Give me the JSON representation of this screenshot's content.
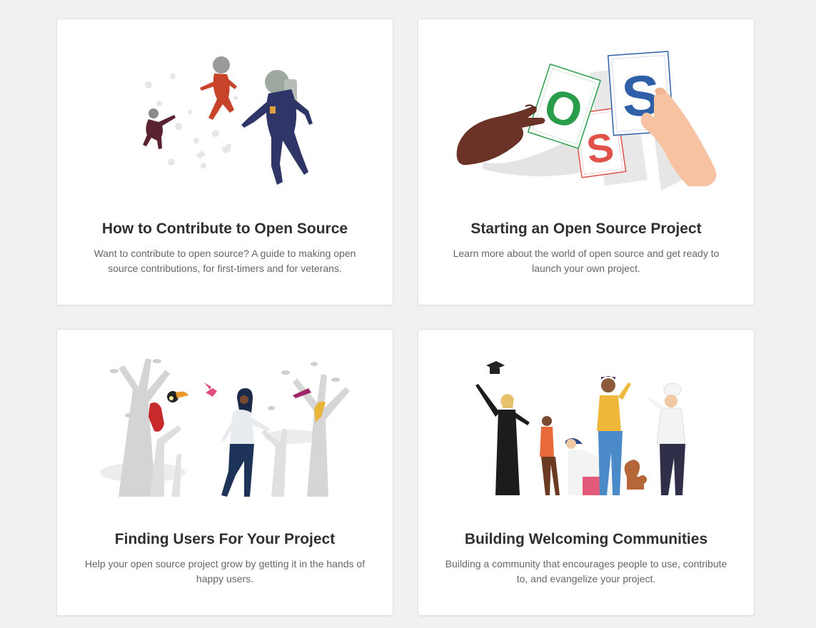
{
  "cards": [
    {
      "title": "How to Contribute to Open Source",
      "description": "Want to contribute to open source? A guide to making open source contributions, for first-timers and for veterans.",
      "illustration": "astronauts-floating-illustration"
    },
    {
      "title": "Starting an Open Source Project",
      "description": "Learn more about the world of open source and get ready to launch your own project.",
      "illustration": "oss-letter-cards-illustration",
      "letters": [
        "O",
        "S",
        "S"
      ]
    },
    {
      "title": "Finding Users For Your Project",
      "description": "Help your open source project grow by getting it in the hands of happy users.",
      "illustration": "forest-birds-illustration"
    },
    {
      "title": "Building Welcoming Communities",
      "description": "Building a community that encourages people to use, contribute to, and evangelize your project.",
      "illustration": "diverse-people-celebrating-illustration"
    }
  ],
  "colors": {
    "background": "#f1f1f1",
    "card": "#ffffff",
    "title": "#2f2f2f",
    "description": "#666666",
    "letter_o": "#2a9d4a",
    "letter_s_red": "#e0514a",
    "letter_s_blue": "#2f5fa8"
  }
}
